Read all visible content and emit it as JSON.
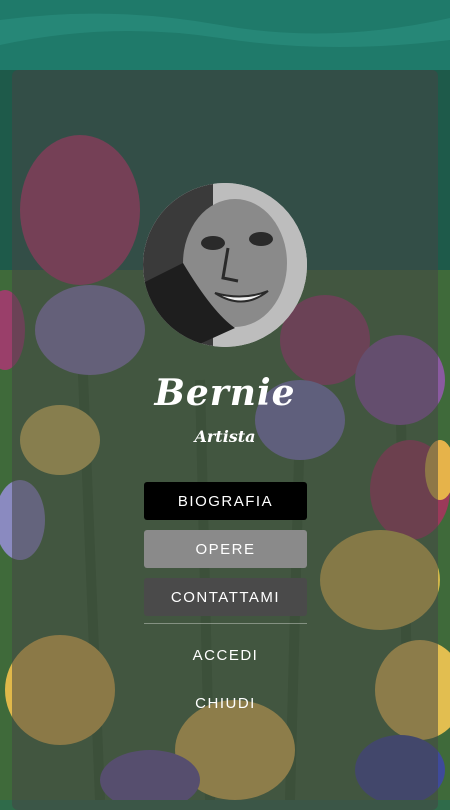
{
  "profile": {
    "name": "Bernie",
    "role": "Artista"
  },
  "menu": {
    "biography_label": "BIOGRAFIA",
    "works_label": "OPERE",
    "contact_label": "CONTATTAMI",
    "login_label": "ACCEDI",
    "close_label": "CHIUDI"
  },
  "colors": {
    "panel_overlay": "rgba(70,70,70,0.55)",
    "active_button": "#000000",
    "hover_button": "#8a8a8a",
    "default_button": "#4a4a4a",
    "text": "#ffffff"
  }
}
